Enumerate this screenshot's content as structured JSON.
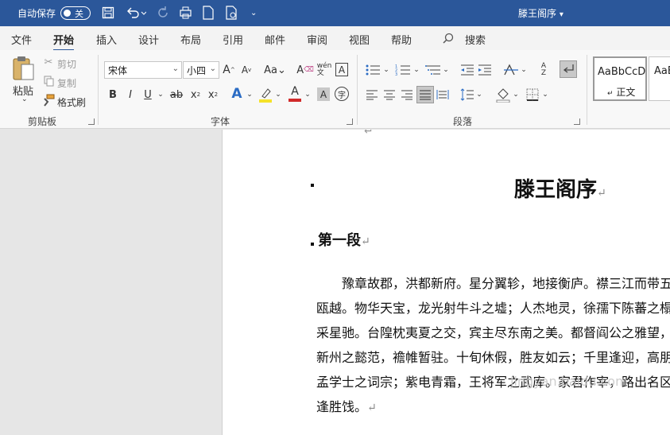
{
  "titlebar": {
    "autosave_label": "自动保存",
    "autosave_state": "关",
    "doc_title": "滕王阁序",
    "dropdown": "▾"
  },
  "tabs": [
    "文件",
    "开始",
    "插入",
    "设计",
    "布局",
    "引用",
    "邮件",
    "审阅",
    "视图",
    "帮助",
    "搜索"
  ],
  "ribbon": {
    "clipboard": {
      "paste": "粘贴",
      "cut": "剪切",
      "copy": "复制",
      "format_painter": "格式刷",
      "label": "剪贴板"
    },
    "font": {
      "font_name": "宋体",
      "font_size": "小四",
      "label": "字体"
    },
    "paragraph": {
      "label": "段落"
    },
    "styles": {
      "style1_preview": "AaBbCcD",
      "style1_name": "正文",
      "style2_preview": "AaB"
    }
  },
  "document": {
    "title": "滕王阁序",
    "heading": "第一段",
    "paragraph_lines": [
      "豫章故郡，洪都新府。星分翼轸，地接衡庐。襟三江而带五",
      "瓯越。物华天宝，龙光射牛斗之墟；人杰地灵，徐孺下陈蕃之榻",
      "采星驰。台隍枕夷夏之交，宾主尽东南之美。都督阎公之雅望，",
      "新州之懿范，襜帷暂驻。十旬休假，胜友如云；千里逢迎，高朋满",
      "孟学士之词宗；紫电青霜，王将军之武库。家君作宰，路出名区",
      "逢胜饯。"
    ],
    "para_mark": "↵",
    "watermark": "jingyan.baidu.com"
  }
}
